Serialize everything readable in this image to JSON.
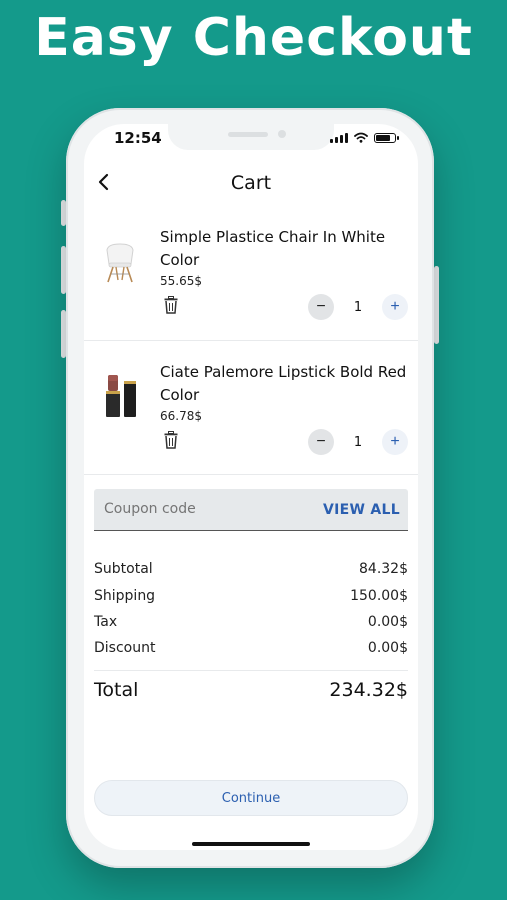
{
  "headline": "Easy Checkout",
  "status_bar": {
    "time": "12:54"
  },
  "header": {
    "title": "Cart"
  },
  "cart": {
    "items": [
      {
        "name": "Simple Plastice Chair In White Color",
        "price": "55.65$",
        "quantity": "1",
        "image": "chair-image"
      },
      {
        "name": "Ciate Palemore Lipstick Bold Red Color",
        "price": "66.78$",
        "quantity": "1",
        "image": "lipstick-image"
      }
    ]
  },
  "coupon": {
    "placeholder": "Coupon code",
    "view_all_label": "VIEW ALL"
  },
  "summary": {
    "subtotal_label": "Subtotal",
    "subtotal_value": "84.32$",
    "shipping_label": "Shipping",
    "shipping_value": "150.00$",
    "tax_label": "Tax",
    "tax_value": "0.00$",
    "discount_label": "Discount",
    "discount_value": "0.00$",
    "total_label": "Total",
    "total_value": "234.32$"
  },
  "actions": {
    "continue_label": "Continue"
  },
  "colors": {
    "background": "#149a8b",
    "accent": "#2b5fb0"
  }
}
